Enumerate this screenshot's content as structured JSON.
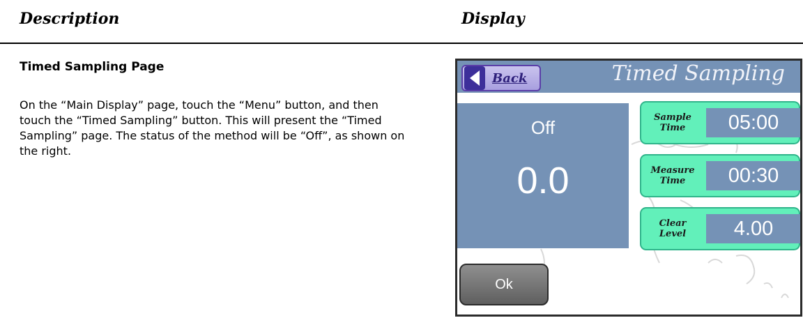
{
  "columns": {
    "description": "Description",
    "display": "Display"
  },
  "section": {
    "title": "Timed Sampling Page",
    "body": "On the “Main Display” page, touch the “Menu” button, and then touch the “Timed Sampling” button.  This will present the “Timed Sampling” page.  The status of the method will be “Off”, as shown on the right."
  },
  "screen": {
    "back_label": "Back",
    "title": "Timed Sampling",
    "status": "Off",
    "reading": "0.0",
    "params": [
      {
        "label": "Sample Time",
        "value": "05:00"
      },
      {
        "label": "Measure Time",
        "value": "00:30"
      },
      {
        "label": "Clear Level",
        "value": "4.00"
      }
    ],
    "ok_label": "Ok",
    "colors": {
      "panel": "#7592b6",
      "param_bg": "#62f0ba",
      "back_bg": "#b9b1e8",
      "back_arrow": "#3d2f9a"
    }
  }
}
